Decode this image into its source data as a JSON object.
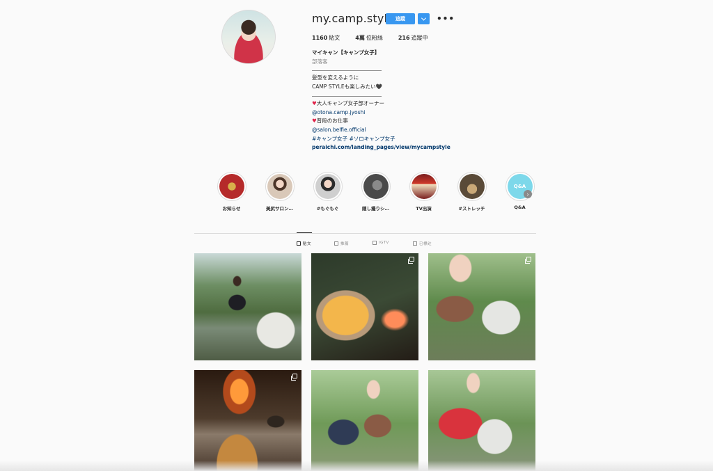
{
  "profile": {
    "username": "my.camp.style",
    "follow_label": "追蹤",
    "stats": [
      {
        "value": "1160",
        "label": "貼文"
      },
      {
        "value": "4萬",
        "label": "位粉絲"
      },
      {
        "value": "216",
        "label": "追蹤中"
      }
    ],
    "bio": {
      "name": "マイキャン【キャンプ女子】",
      "category": "部落客",
      "line1": "髪型を変えるように",
      "line2": "CAMP STYLEも楽しみたい🖤",
      "owner_heart": "♥",
      "owner_text": "大人キャンプ女子部オーナー",
      "owner_link": "@otona.camp.jyoshi",
      "work_heart": "♥",
      "work_text": "普段のお仕事",
      "work_link": "@salon.belfie.official",
      "hashtags": "#キャンプ女子 #ソロキャンプ女子",
      "url": "peraichi.com/landing_pages/view/mycampstyle"
    }
  },
  "highlights": [
    {
      "label": "お知らせ",
      "badge": ""
    },
    {
      "label": "美尻サロン…",
      "badge": ""
    },
    {
      "label": "#もぐもぐ",
      "badge": ""
    },
    {
      "label": "隠し撮りシ…",
      "badge": ""
    },
    {
      "label": "TV出演",
      "badge": ""
    },
    {
      "label": "#ストレッチ",
      "badge": ""
    },
    {
      "label": "Q&A",
      "badge": "Q&A"
    }
  ],
  "highlights_next": "›",
  "tabs": [
    {
      "label": "貼文",
      "icon": "grid-icon"
    },
    {
      "label": "推薦",
      "icon": "feed-icon"
    },
    {
      "label": "IGTV",
      "icon": "igtv-icon"
    },
    {
      "label": "已標註",
      "icon": "tag-icon"
    }
  ],
  "more_icon": "•••",
  "colors": {
    "accent": "#3897f0",
    "link": "#00376b",
    "heart": "#e0244a",
    "background": "#fafafa"
  }
}
